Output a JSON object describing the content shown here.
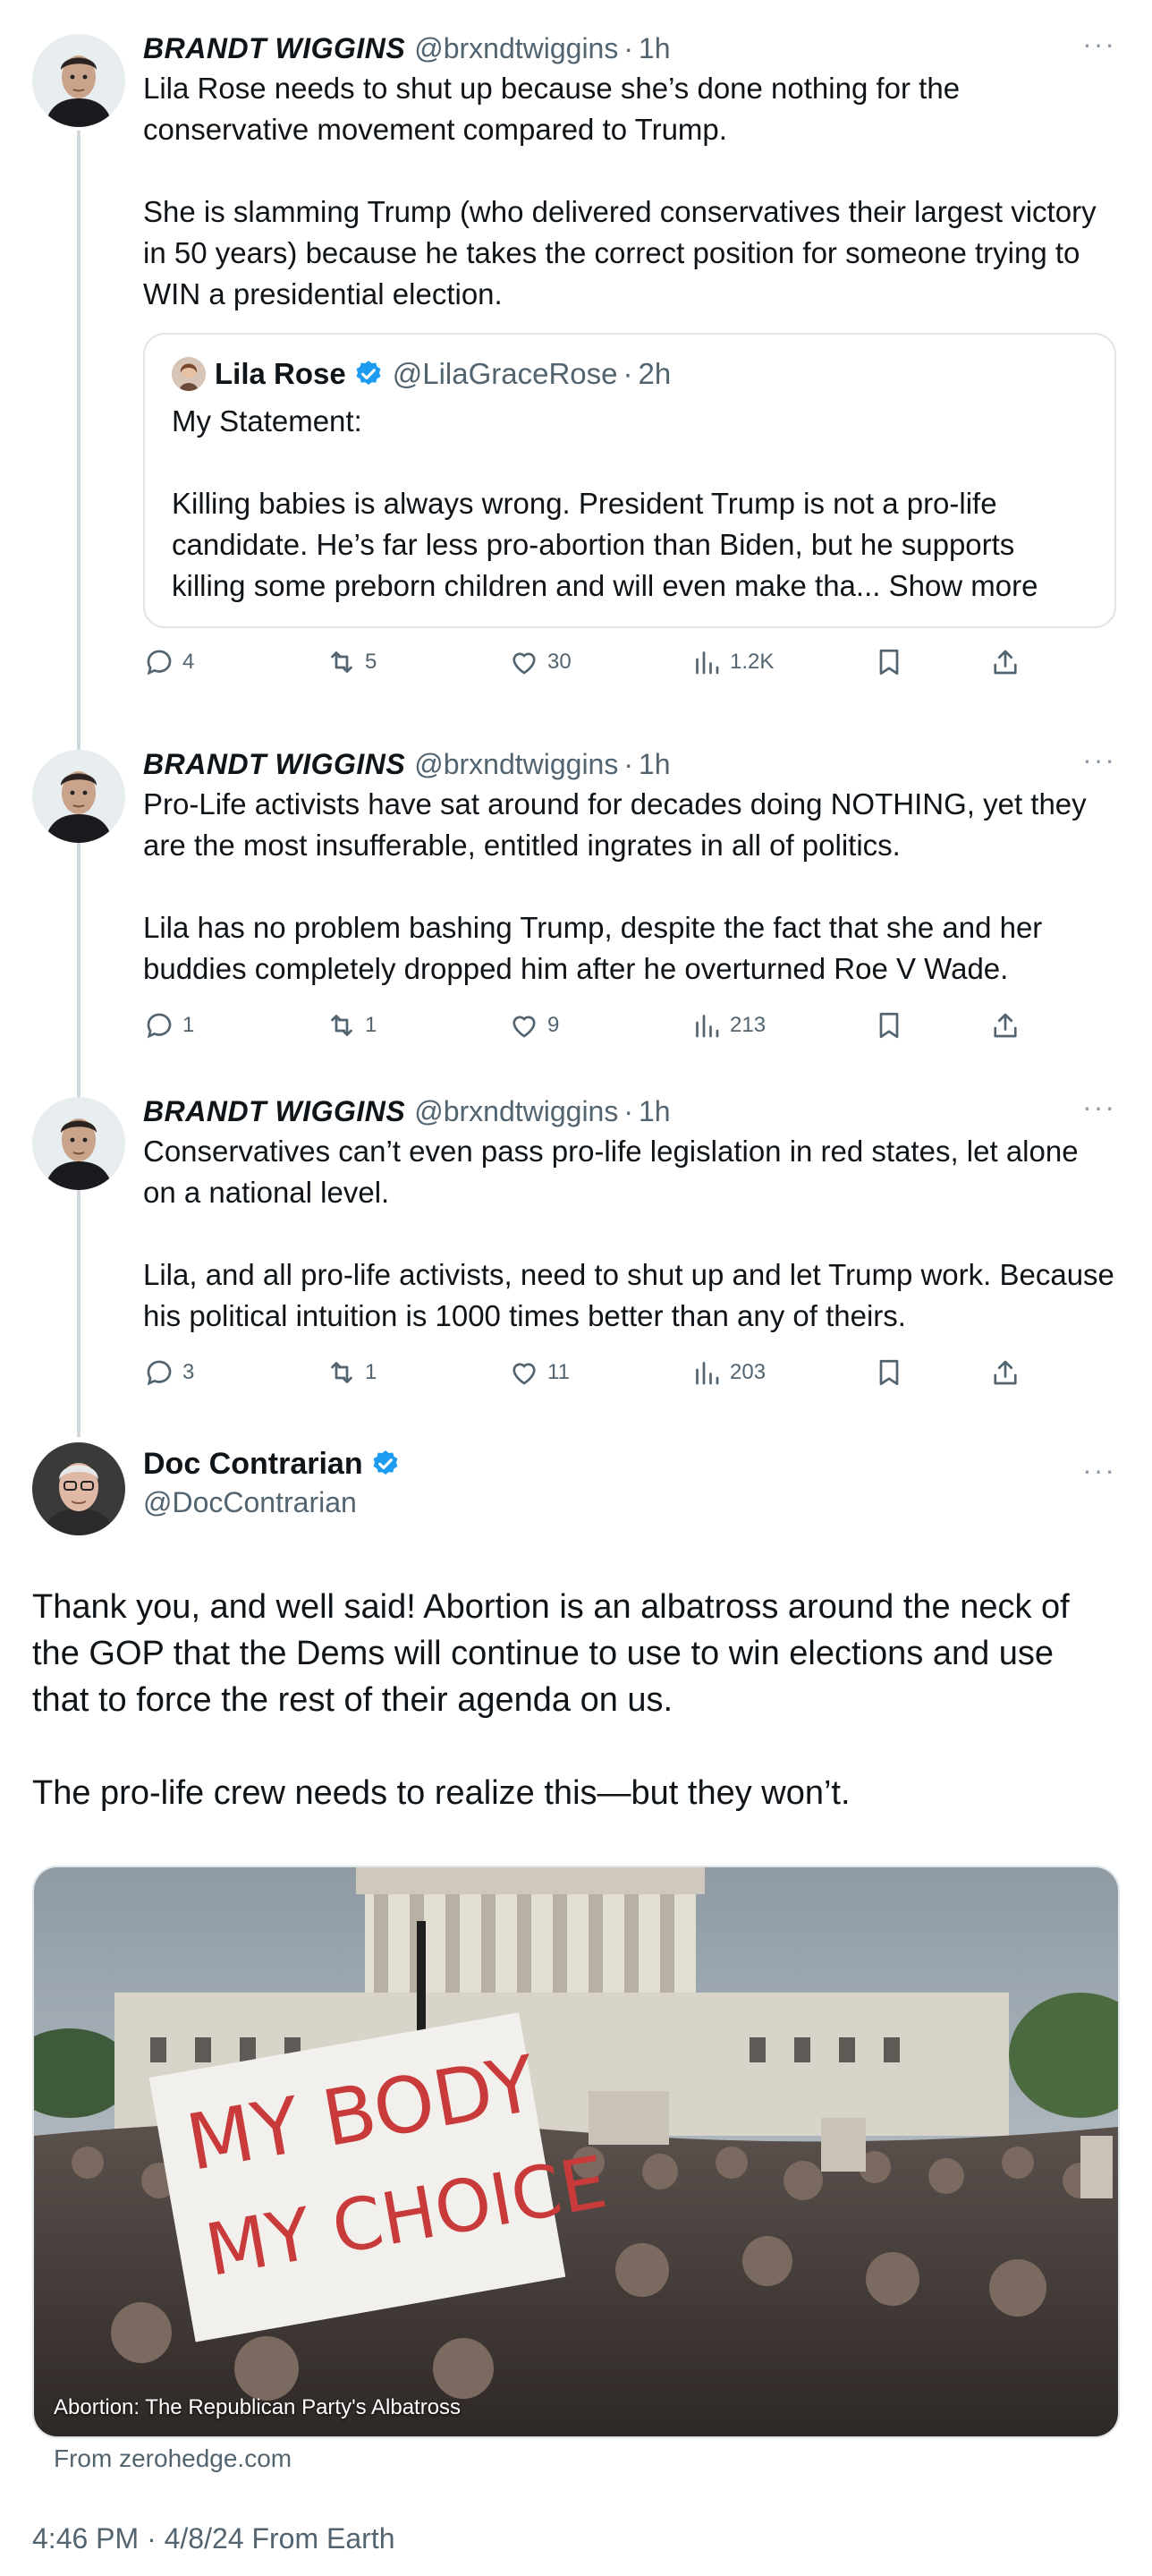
{
  "replies": [
    {
      "name": "BRANDT WIGGINS",
      "handle": "@brxndtwiggins",
      "time": "1h",
      "text": "Lila Rose needs to shut up because she’s done nothing for the conservative movement compared to Trump.\n\nShe is slamming Trump (who delivered conservatives their largest victory in 50 years) because he takes the correct position for someone trying to WIN a presidential election.",
      "quote": {
        "name": "Lila Rose",
        "handle": "@LilaGraceRose",
        "time": "2h",
        "text": "My Statement:\n\nKilling babies is always wrong. President Trump is not a pro-life candidate. He’s far less pro-abortion than Biden, but he supports killing some preborn children and will even make tha...",
        "show_more": " Show more"
      },
      "replies_count": "4",
      "reposts": "5",
      "likes": "30",
      "views": "1.2K"
    },
    {
      "name": "BRANDT WIGGINS",
      "handle": "@brxndtwiggins",
      "time": "1h",
      "text": "Pro-Life activists have sat around for decades doing NOTHING, yet they are the most insufferable, entitled ingrates in all of politics.\n\nLila has no problem bashing Trump, despite the fact that she and her buddies completely dropped him after he overturned Roe V Wade.",
      "replies_count": "1",
      "reposts": "1",
      "likes": "9",
      "views": "213"
    },
    {
      "name": "BRANDT WIGGINS",
      "handle": "@brxndtwiggins",
      "time": "1h",
      "text": "Conservatives can’t even pass pro-life legislation in red states, let alone on a national level.\n\nLila, and all pro-life activists, need to shut up and let Trump work. Because his political intuition is 1000 times better than any of theirs.",
      "replies_count": "3",
      "reposts": "1",
      "likes": "11",
      "views": "203"
    }
  ],
  "main": {
    "name": "Doc Contrarian",
    "handle": "@DocContrarian",
    "text": "Thank you, and well said! Abortion is an albatross around the neck of the GOP that the Dems will continue to use to win elections and use that to force the rest of their agenda on us.\n\nThe pro-life crew needs to realize this—but they won’t.",
    "media": {
      "caption": "Abortion: The Republican Party's Albatross",
      "sign_line1": "MY BODY",
      "sign_line2": "MY CHOICE"
    },
    "source": "From zerohedge.com",
    "timestamp": "4:46 PM · 4/8/24 From Earth"
  },
  "ui": {
    "more": "···",
    "dot": "·"
  },
  "colors": {
    "verified": "#1d9bf0",
    "muted": "#536471",
    "thread_line": "#cfd9de"
  }
}
